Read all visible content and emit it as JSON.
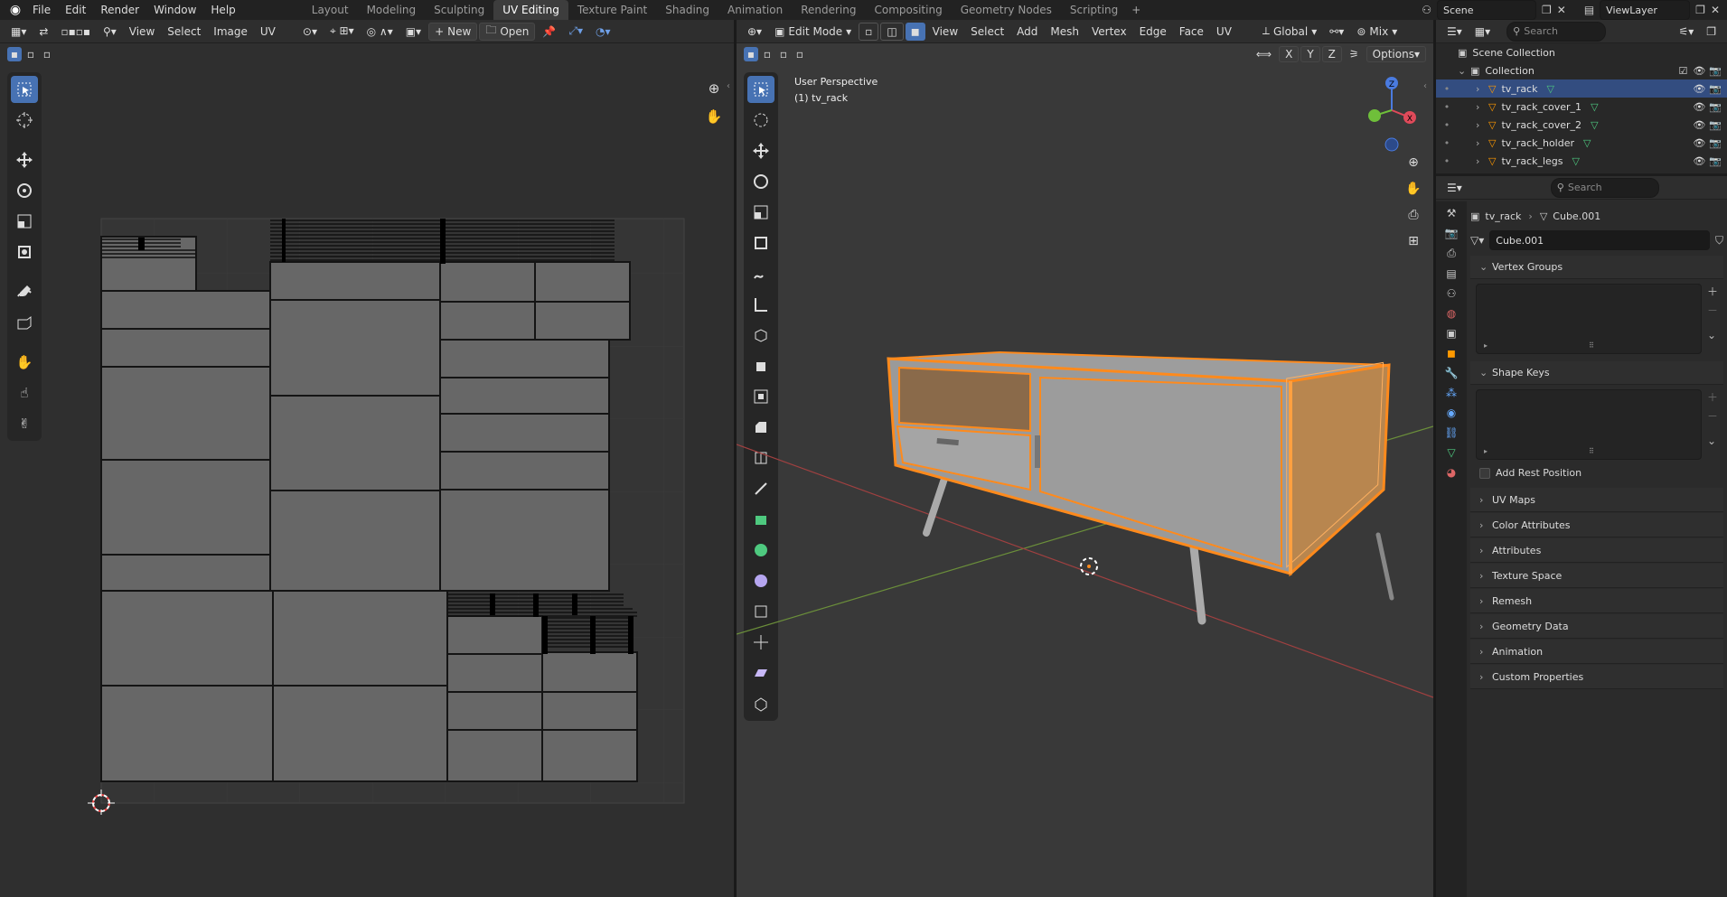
{
  "menus": [
    "File",
    "Edit",
    "Render",
    "Window",
    "Help"
  ],
  "workspaces": [
    "Layout",
    "Modeling",
    "Sculpting",
    "UV Editing",
    "Texture Paint",
    "Shading",
    "Animation",
    "Rendering",
    "Compositing",
    "Geometry Nodes",
    "Scripting"
  ],
  "active_workspace": "UV Editing",
  "scene": {
    "label": "Scene",
    "viewlayer": "ViewLayer"
  },
  "uv_editor": {
    "menus": [
      "View",
      "Select",
      "Image",
      "UV"
    ],
    "new_label": "New",
    "open_label": "Open"
  },
  "viewport": {
    "mode_label": "Edit Mode",
    "menus": [
      "View",
      "Select",
      "Add",
      "Mesh",
      "Vertex",
      "Edge",
      "Face",
      "UV"
    ],
    "transform_orientation": "Global",
    "snap_label": "Mix",
    "options_label": "Options",
    "axes": [
      "X",
      "Y",
      "Z"
    ],
    "overlay_title": "User Perspective",
    "overlay_object": "(1) tv_rack"
  },
  "outliner": {
    "search_placeholder": "Search",
    "scene_collection": "Scene Collection",
    "collection": "Collection",
    "objects": [
      "tv_rack",
      "tv_rack_cover_1",
      "tv_rack_cover_2",
      "tv_rack_holder",
      "tv_rack_legs"
    ],
    "selected": "tv_rack"
  },
  "properties": {
    "search_placeholder": "Search",
    "breadcrumb_object": "tv_rack",
    "breadcrumb_data": "Cube.001",
    "mesh_name": "Cube.001",
    "panels_open": [
      "Vertex Groups",
      "Shape Keys"
    ],
    "add_rest_position": "Add Rest Position",
    "panels_closed": [
      "UV Maps",
      "Color Attributes",
      "Attributes",
      "Texture Space",
      "Remesh",
      "Geometry Data",
      "Animation",
      "Custom Properties"
    ]
  },
  "colors": {
    "accent": "#4772b3",
    "selection": "#ff8a1c",
    "mesh_gray": "#9a9a9a"
  }
}
